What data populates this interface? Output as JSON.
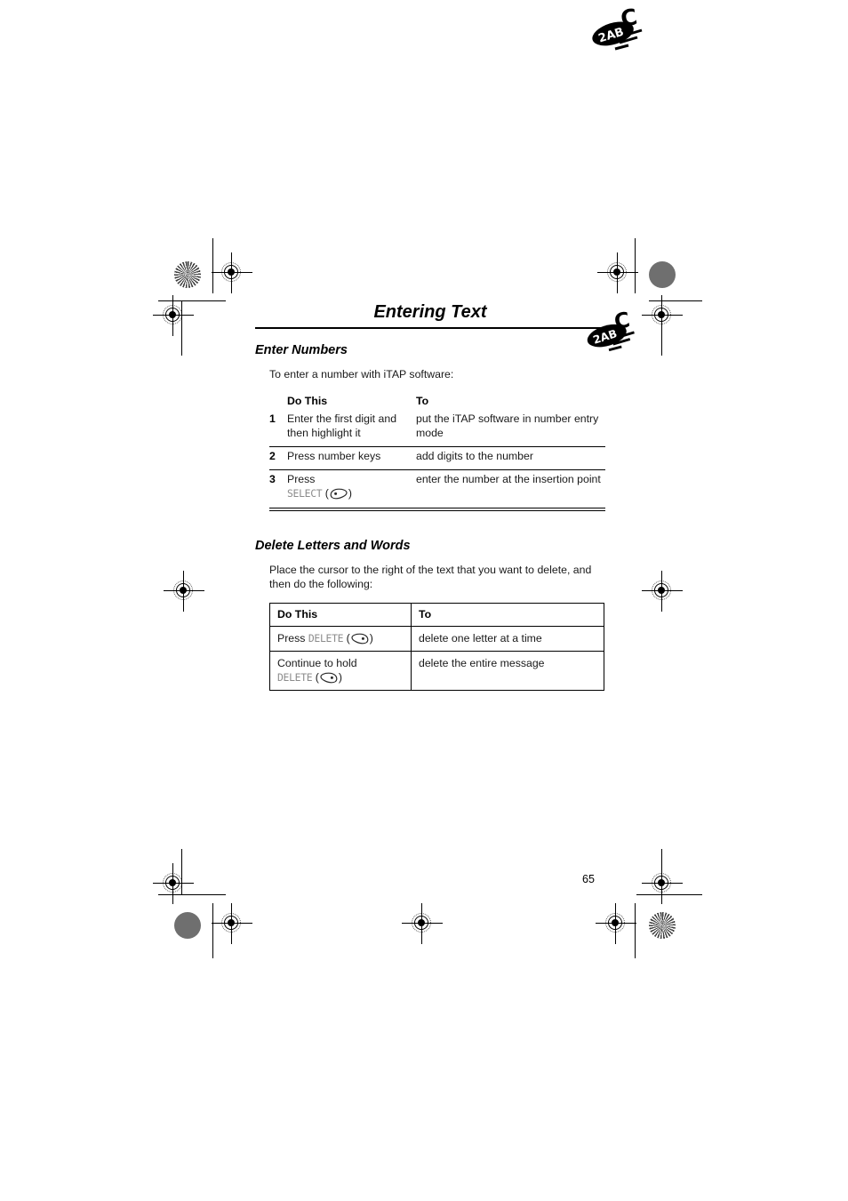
{
  "page": {
    "number": "65",
    "chapter_title": "Entering Text",
    "logo_name": "itap-logo",
    "logo_text": {
      "oval": "2AB",
      "outside": "C"
    }
  },
  "sections": [
    {
      "heading": "Enter Numbers",
      "intro": "To enter a number with iTAP software:",
      "table": {
        "style": "steps",
        "headers": [
          "Do This",
          "To"
        ],
        "rows": [
          {
            "num": "1",
            "do_this": "Enter the first digit and then highlight it",
            "to": "put the iTAP software in number entry mode"
          },
          {
            "num": "2",
            "do_this": "Press number keys",
            "to": "add digits to the number"
          },
          {
            "num": "3",
            "do_this_prefix": "Press",
            "do_this_key": "SELECT",
            "do_this_key_glyph": "select-key-icon",
            "to": "enter the number at the insertion point"
          }
        ]
      }
    },
    {
      "heading": "Delete Letters and Words",
      "intro": "Place the cursor to the right of the text that you want to delete, and then do the following:",
      "table": {
        "style": "grid",
        "headers": [
          "Do This",
          "To"
        ],
        "rows": [
          {
            "do_this_prefix": "Press",
            "do_this_key": "DELETE",
            "do_this_key_glyph": "delete-key-icon",
            "to": "delete one letter at a time"
          },
          {
            "do_this_prefix": "Continue to hold",
            "do_this_key": "DELETE",
            "do_this_key_glyph": "delete-key-icon",
            "to": "delete the entire message"
          }
        ]
      }
    }
  ]
}
